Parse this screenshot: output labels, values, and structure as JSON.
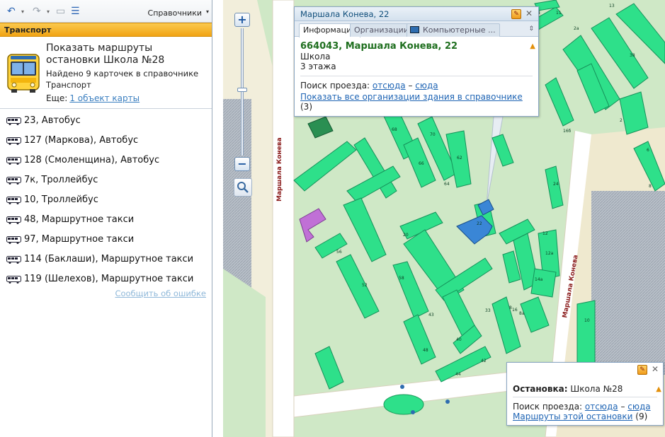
{
  "left": {
    "toolbar": {
      "back_icon": "back-arrow-icon",
      "forward_icon": "forward-arrow-icon",
      "print_icon": "print-icon",
      "layout_icon": "layout-icon",
      "directories_label": "Справочники"
    },
    "section_title": "Транспорт",
    "card": {
      "title": "Показать маршруты остановки Школа №28",
      "found": "Найдено 9 карточек в справочнике",
      "category": "Транспорт",
      "more_label": "Еще:",
      "more_link": "1 объект карты"
    },
    "routes": [
      "23, Автобус",
      "127 (Маркова), Автобус",
      "128 (Смоленщина), Автобус",
      "7к, Троллейбус",
      "10, Троллейбус",
      "48, Маршрутное такси",
      "97, Маршрутное такси",
      "114 (Баклаши), Маршрутное такси",
      "119 (Шелехов), Маршрутное такси"
    ],
    "report_error": "Сообщить об ошибке"
  },
  "map": {
    "streets": [
      "Маршала Конева",
      "Маршала Конева"
    ],
    "building_numbers": [
      "68",
      "70",
      "66",
      "64",
      "62",
      "22",
      "20",
      "56",
      "58",
      "52",
      "43",
      "33",
      "40",
      "48",
      "42",
      "44",
      "12",
      "12а",
      "16",
      "14а",
      "8",
      "8а",
      "16б",
      "24",
      "2",
      "38",
      "2а",
      "6",
      "8",
      "10",
      "11",
      "13",
      "14"
    ],
    "popup_top": {
      "header": "Маршала Конева, 22",
      "tabs": [
        "Информация",
        "Организации",
        "Компьютерные ..."
      ],
      "address": "664043, Маршала Конева, 22",
      "type": "Школа",
      "floors": "3 этажа",
      "route_label": "Поиск проезда:",
      "from_here": "отсюда",
      "dash": "–",
      "to_here": "сюда",
      "show_all": "Показать все организации здания в справочнике",
      "show_all_count": "(3)"
    },
    "popup_stop": {
      "stop_label": "Остановка:",
      "stop_name": "Школа №28",
      "route_label": "Поиск проезда:",
      "from_here": "отсюда",
      "dash": "–",
      "to_here": "сюда",
      "routes_link": "Маршруты этой остановки",
      "routes_count": "(9)"
    }
  },
  "colors": {
    "accent": "#f1a414",
    "link": "#1e64b4",
    "building": "#2ee08a",
    "school": "#3a86d6",
    "purple": "#c070d6",
    "map_bg": "#cfe8c6"
  }
}
